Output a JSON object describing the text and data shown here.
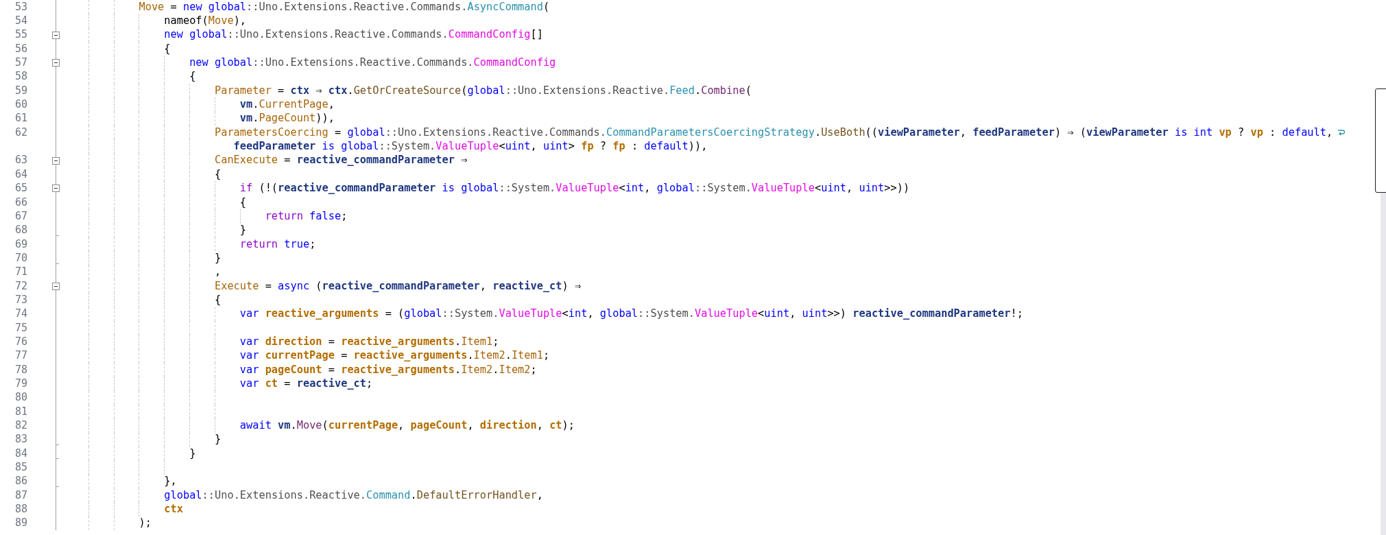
{
  "editor": {
    "lines": [
      {
        "number": "53",
        "fold_start": false,
        "fold_end": false,
        "wrapped": false,
        "tokens": [
          {
            "kind": "prop",
            "text": "            Move"
          },
          {
            "kind": "p",
            "text": " = "
          },
          {
            "kind": "kw",
            "text": "new global"
          },
          {
            "kind": "ns",
            "text": "::Uno.Extensions.Reactive.Commands."
          },
          {
            "kind": "cls",
            "text": "AsyncCommand"
          },
          {
            "kind": "p",
            "text": "("
          }
        ]
      },
      {
        "number": "54",
        "fold_start": false,
        "fold_end": false,
        "wrapped": false,
        "tokens": [
          {
            "kind": "p",
            "text": "                nameof("
          },
          {
            "kind": "prop",
            "text": "Move"
          },
          {
            "kind": "p",
            "text": "),"
          }
        ]
      },
      {
        "number": "55",
        "fold_start": true,
        "fold_end": false,
        "wrapped": false,
        "tokens": [
          {
            "kind": "kw",
            "text": "                new global"
          },
          {
            "kind": "ns",
            "text": "::Uno.Extensions.Reactive.Commands."
          },
          {
            "kind": "st",
            "text": "CommandConfig"
          },
          {
            "kind": "p",
            "text": "[]"
          }
        ]
      },
      {
        "number": "56",
        "fold_start": false,
        "fold_end": false,
        "wrapped": false,
        "tokens": [
          {
            "kind": "p",
            "text": "                {"
          }
        ]
      },
      {
        "number": "57",
        "fold_start": true,
        "fold_end": false,
        "wrapped": false,
        "tokens": [
          {
            "kind": "kw",
            "text": "                    new global"
          },
          {
            "kind": "ns",
            "text": "::Uno.Extensions.Reactive.Commands."
          },
          {
            "kind": "st",
            "text": "CommandConfig"
          }
        ]
      },
      {
        "number": "58",
        "fold_start": false,
        "fold_end": false,
        "wrapped": false,
        "tokens": [
          {
            "kind": "p",
            "text": "                    {"
          }
        ]
      },
      {
        "number": "59",
        "fold_start": false,
        "fold_end": false,
        "wrapped": false,
        "tokens": [
          {
            "kind": "prop",
            "text": "                        Parameter"
          },
          {
            "kind": "p",
            "text": " = "
          },
          {
            "kind": "param",
            "text": "ctx"
          },
          {
            "kind": "p",
            "text": " ⇒ "
          },
          {
            "kind": "param",
            "text": "ctx"
          },
          {
            "kind": "p",
            "text": "."
          },
          {
            "kind": "meth",
            "text": "GetOrCreateSource"
          },
          {
            "kind": "p",
            "text": "("
          },
          {
            "kind": "kw",
            "text": "global"
          },
          {
            "kind": "ns",
            "text": "::Uno.Extensions.Reactive."
          },
          {
            "kind": "cls",
            "text": "Feed"
          },
          {
            "kind": "p",
            "text": "."
          },
          {
            "kind": "meth2",
            "text": "Combine"
          },
          {
            "kind": "p",
            "text": "("
          }
        ]
      },
      {
        "number": "60",
        "fold_start": false,
        "fold_end": false,
        "wrapped": false,
        "tokens": [
          {
            "kind": "param",
            "text": "                            vm"
          },
          {
            "kind": "p",
            "text": "."
          },
          {
            "kind": "prop",
            "text": "CurrentPage"
          },
          {
            "kind": "p",
            "text": ","
          }
        ]
      },
      {
        "number": "61",
        "fold_start": false,
        "fold_end": false,
        "wrapped": false,
        "tokens": [
          {
            "kind": "param",
            "text": "                            vm"
          },
          {
            "kind": "p",
            "text": "."
          },
          {
            "kind": "prop",
            "text": "PageCount"
          },
          {
            "kind": "p",
            "text": ")),"
          }
        ]
      },
      {
        "number": "62",
        "fold_start": false,
        "fold_end": false,
        "wrapped": true,
        "tokens": [
          {
            "kind": "prop",
            "text": "                        ParametersCoercing"
          },
          {
            "kind": "p",
            "text": " = "
          },
          {
            "kind": "kw",
            "text": "global"
          },
          {
            "kind": "ns",
            "text": "::Uno.Extensions.Reactive.Commands."
          },
          {
            "kind": "cls",
            "text": "CommandParametersCoercingStrategy"
          },
          {
            "kind": "p",
            "text": "."
          },
          {
            "kind": "meth",
            "text": "UseBoth"
          },
          {
            "kind": "p",
            "text": "(("
          },
          {
            "kind": "param",
            "text": "viewParameter"
          },
          {
            "kind": "p",
            "text": ", "
          },
          {
            "kind": "param",
            "text": "feedParameter"
          },
          {
            "kind": "p",
            "text": ") ⇒ ("
          },
          {
            "kind": "param",
            "text": "viewParameter"
          },
          {
            "kind": "kw",
            "text": " is int "
          },
          {
            "kind": "local",
            "text": "vp"
          },
          {
            "kind": "p",
            "text": " ? "
          },
          {
            "kind": "local",
            "text": "vp"
          },
          {
            "kind": "p",
            "text": " : "
          },
          {
            "kind": "kw",
            "text": "default"
          },
          {
            "kind": "p",
            "text": ","
          }
        ],
        "continuation": [
          {
            "kind": "param",
            "text": "                           feedParameter"
          },
          {
            "kind": "kw",
            "text": " is global"
          },
          {
            "kind": "ns",
            "text": "::System."
          },
          {
            "kind": "st",
            "text": "ValueTuple"
          },
          {
            "kind": "p",
            "text": "<"
          },
          {
            "kind": "kw",
            "text": "uint"
          },
          {
            "kind": "p",
            "text": ", "
          },
          {
            "kind": "kw",
            "text": "uint"
          },
          {
            "kind": "p",
            "text": "> "
          },
          {
            "kind": "local",
            "text": "fp"
          },
          {
            "kind": "p",
            "text": " ? "
          },
          {
            "kind": "local",
            "text": "fp"
          },
          {
            "kind": "p",
            "text": " : "
          },
          {
            "kind": "kw",
            "text": "default"
          },
          {
            "kind": "p",
            "text": ")),"
          }
        ]
      },
      {
        "number": "63",
        "fold_start": true,
        "fold_end": false,
        "wrapped": false,
        "tokens": [
          {
            "kind": "prop",
            "text": "                        CanExecute"
          },
          {
            "kind": "p",
            "text": " = "
          },
          {
            "kind": "param",
            "text": "reactive_commandParameter"
          },
          {
            "kind": "p",
            "text": " ⇒"
          }
        ]
      },
      {
        "number": "64",
        "fold_start": false,
        "fold_end": false,
        "wrapped": false,
        "tokens": [
          {
            "kind": "p",
            "text": "                        {"
          }
        ]
      },
      {
        "number": "65",
        "fold_start": true,
        "fold_end": false,
        "wrapped": false,
        "tokens": [
          {
            "kind": "ctl",
            "text": "                            if"
          },
          {
            "kind": "p",
            "text": " (!("
          },
          {
            "kind": "param",
            "text": "reactive_commandParameter"
          },
          {
            "kind": "kw",
            "text": " is global"
          },
          {
            "kind": "ns",
            "text": "::System."
          },
          {
            "kind": "st",
            "text": "ValueTuple"
          },
          {
            "kind": "p",
            "text": "<"
          },
          {
            "kind": "kw",
            "text": "int"
          },
          {
            "kind": "p",
            "text": ", "
          },
          {
            "kind": "kw",
            "text": "global"
          },
          {
            "kind": "ns",
            "text": "::System."
          },
          {
            "kind": "st",
            "text": "ValueTuple"
          },
          {
            "kind": "p",
            "text": "<"
          },
          {
            "kind": "kw",
            "text": "uint"
          },
          {
            "kind": "p",
            "text": ", "
          },
          {
            "kind": "kw",
            "text": "uint"
          },
          {
            "kind": "p",
            "text": ">>))"
          }
        ]
      },
      {
        "number": "66",
        "fold_start": false,
        "fold_end": false,
        "wrapped": false,
        "tokens": [
          {
            "kind": "p",
            "text": "                            {"
          }
        ]
      },
      {
        "number": "67",
        "fold_start": false,
        "fold_end": false,
        "wrapped": false,
        "tokens": [
          {
            "kind": "ctl",
            "text": "                                return"
          },
          {
            "kind": "kw",
            "text": " false"
          },
          {
            "kind": "p",
            "text": ";"
          }
        ]
      },
      {
        "number": "68",
        "fold_start": false,
        "fold_end": true,
        "wrapped": false,
        "tokens": [
          {
            "kind": "p",
            "text": "                            }"
          }
        ]
      },
      {
        "number": "69",
        "fold_start": false,
        "fold_end": false,
        "wrapped": false,
        "tokens": [
          {
            "kind": "ctl",
            "text": "                            return"
          },
          {
            "kind": "kw",
            "text": " true"
          },
          {
            "kind": "p",
            "text": ";"
          }
        ]
      },
      {
        "number": "70",
        "fold_start": false,
        "fold_end": true,
        "wrapped": false,
        "tokens": [
          {
            "kind": "p",
            "text": "                        }"
          }
        ]
      },
      {
        "number": "71",
        "fold_start": false,
        "fold_end": false,
        "wrapped": false,
        "tokens": [
          {
            "kind": "p",
            "text": "                        ,"
          }
        ]
      },
      {
        "number": "72",
        "fold_start": true,
        "fold_end": false,
        "wrapped": false,
        "tokens": [
          {
            "kind": "prop",
            "text": "                        Execute"
          },
          {
            "kind": "p",
            "text": " = "
          },
          {
            "kind": "kw",
            "text": "async"
          },
          {
            "kind": "p",
            "text": " ("
          },
          {
            "kind": "param",
            "text": "reactive_commandParameter"
          },
          {
            "kind": "p",
            "text": ", "
          },
          {
            "kind": "param",
            "text": "reactive_ct"
          },
          {
            "kind": "p",
            "text": ") ⇒"
          }
        ]
      },
      {
        "number": "73",
        "fold_start": false,
        "fold_end": false,
        "wrapped": false,
        "tokens": [
          {
            "kind": "p",
            "text": "                        {"
          }
        ]
      },
      {
        "number": "74",
        "fold_start": false,
        "fold_end": false,
        "wrapped": false,
        "tokens": [
          {
            "kind": "kw",
            "text": "                            var"
          },
          {
            "kind": "local",
            "text": " reactive_arguments"
          },
          {
            "kind": "p",
            "text": " = ("
          },
          {
            "kind": "kw",
            "text": "global"
          },
          {
            "kind": "ns",
            "text": "::System."
          },
          {
            "kind": "st",
            "text": "ValueTuple"
          },
          {
            "kind": "p",
            "text": "<"
          },
          {
            "kind": "kw",
            "text": "int"
          },
          {
            "kind": "p",
            "text": ", "
          },
          {
            "kind": "kw",
            "text": "global"
          },
          {
            "kind": "ns",
            "text": "::System."
          },
          {
            "kind": "st",
            "text": "ValueTuple"
          },
          {
            "kind": "p",
            "text": "<"
          },
          {
            "kind": "kw",
            "text": "uint"
          },
          {
            "kind": "p",
            "text": ", "
          },
          {
            "kind": "kw",
            "text": "uint"
          },
          {
            "kind": "p",
            "text": ">>) "
          },
          {
            "kind": "param",
            "text": "reactive_commandParameter"
          },
          {
            "kind": "p",
            "text": "!;"
          }
        ]
      },
      {
        "number": "75",
        "fold_start": false,
        "fold_end": false,
        "wrapped": false
      },
      {
        "number": "76",
        "fold_start": false,
        "fold_end": false,
        "wrapped": false,
        "tokens": [
          {
            "kind": "kw",
            "text": "                            var"
          },
          {
            "kind": "local",
            "text": " direction"
          },
          {
            "kind": "p",
            "text": " = "
          },
          {
            "kind": "local",
            "text": "reactive_arguments"
          },
          {
            "kind": "p",
            "text": "."
          },
          {
            "kind": "prop",
            "text": "Item1"
          },
          {
            "kind": "p",
            "text": ";"
          }
        ]
      },
      {
        "number": "77",
        "fold_start": false,
        "fold_end": false,
        "wrapped": false,
        "tokens": [
          {
            "kind": "kw",
            "text": "                            var"
          },
          {
            "kind": "local",
            "text": " currentPage"
          },
          {
            "kind": "p",
            "text": " = "
          },
          {
            "kind": "local",
            "text": "reactive_arguments"
          },
          {
            "kind": "p",
            "text": "."
          },
          {
            "kind": "prop",
            "text": "Item2"
          },
          {
            "kind": "p",
            "text": "."
          },
          {
            "kind": "prop",
            "text": "Item1"
          },
          {
            "kind": "p",
            "text": ";"
          }
        ]
      },
      {
        "number": "78",
        "fold_start": false,
        "fold_end": false,
        "wrapped": false,
        "tokens": [
          {
            "kind": "kw",
            "text": "                            var"
          },
          {
            "kind": "local",
            "text": " pageCount"
          },
          {
            "kind": "p",
            "text": " = "
          },
          {
            "kind": "local",
            "text": "reactive_arguments"
          },
          {
            "kind": "p",
            "text": "."
          },
          {
            "kind": "prop",
            "text": "Item2"
          },
          {
            "kind": "p",
            "text": "."
          },
          {
            "kind": "prop",
            "text": "Item2"
          },
          {
            "kind": "p",
            "text": ";"
          }
        ]
      },
      {
        "number": "79",
        "fold_start": false,
        "fold_end": false,
        "wrapped": false,
        "tokens": [
          {
            "kind": "kw",
            "text": "                            var"
          },
          {
            "kind": "local",
            "text": " ct"
          },
          {
            "kind": "p",
            "text": " = "
          },
          {
            "kind": "param",
            "text": "reactive_ct"
          },
          {
            "kind": "p",
            "text": ";"
          }
        ]
      },
      {
        "number": "80",
        "fold_start": false,
        "fold_end": false,
        "wrapped": false
      },
      {
        "number": "81",
        "fold_start": false,
        "fold_end": false,
        "wrapped": false
      },
      {
        "number": "82",
        "fold_start": false,
        "fold_end": false,
        "wrapped": false,
        "tokens": [
          {
            "kind": "kw",
            "text": "                            await"
          },
          {
            "kind": "param",
            "text": " vm"
          },
          {
            "kind": "p",
            "text": "."
          },
          {
            "kind": "meth2",
            "text": "Move"
          },
          {
            "kind": "p",
            "text": "("
          },
          {
            "kind": "local",
            "text": "currentPage"
          },
          {
            "kind": "p",
            "text": ", "
          },
          {
            "kind": "local",
            "text": "pageCount"
          },
          {
            "kind": "p",
            "text": ", "
          },
          {
            "kind": "local",
            "text": "direction"
          },
          {
            "kind": "p",
            "text": ", "
          },
          {
            "kind": "local",
            "text": "ct"
          },
          {
            "kind": "p",
            "text": ");"
          }
        ]
      },
      {
        "number": "83",
        "fold_start": false,
        "fold_end": true,
        "wrapped": false,
        "tokens": [
          {
            "kind": "p",
            "text": "                        }"
          }
        ]
      },
      {
        "number": "84",
        "fold_start": false,
        "fold_end": true,
        "wrapped": false,
        "tokens": [
          {
            "kind": "p",
            "text": "                    }"
          }
        ]
      },
      {
        "number": "85",
        "fold_start": false,
        "fold_end": false,
        "wrapped": false
      },
      {
        "number": "86",
        "fold_start": false,
        "fold_end": true,
        "wrapped": false,
        "tokens": [
          {
            "kind": "p",
            "text": "                },"
          }
        ]
      },
      {
        "number": "87",
        "fold_start": false,
        "fold_end": false,
        "wrapped": false,
        "tokens": [
          {
            "kind": "kw",
            "text": "                global"
          },
          {
            "kind": "ns",
            "text": "::Uno.Extensions.Reactive."
          },
          {
            "kind": "cls",
            "text": "Command"
          },
          {
            "kind": "p",
            "text": "."
          },
          {
            "kind": "meth",
            "text": "DefaultErrorHandler"
          },
          {
            "kind": "p",
            "text": ","
          }
        ]
      },
      {
        "number": "88",
        "fold_start": false,
        "fold_end": false,
        "wrapped": false,
        "tokens": [
          {
            "kind": "local",
            "text": "                ctx"
          }
        ]
      },
      {
        "number": "89",
        "fold_start": false,
        "fold_end": false,
        "wrapped": false,
        "tokens": [
          {
            "kind": "p",
            "text": "            );"
          }
        ]
      }
    ]
  }
}
